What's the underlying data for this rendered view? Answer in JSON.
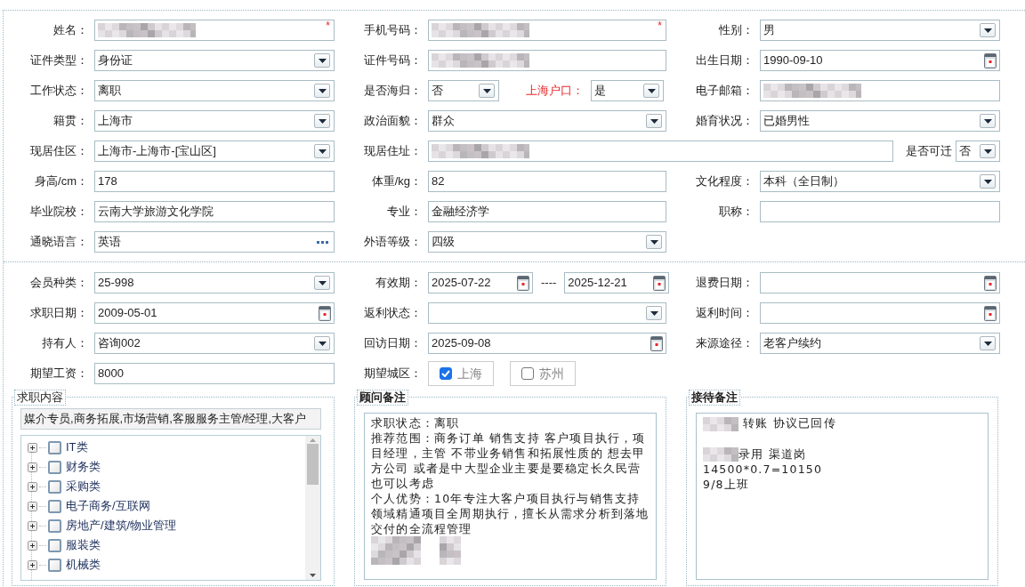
{
  "personal": [
    [
      [
        {
          "label": "姓名：",
          "kind": "text",
          "redacted": true,
          "required_mark": "*"
        }
      ],
      [
        {
          "label": "手机号码：",
          "kind": "text",
          "redacted": true,
          "required_mark": "*"
        }
      ],
      [
        {
          "label": "性别：",
          "kind": "select",
          "value": "男"
        }
      ]
    ],
    [
      [
        {
          "label": "证件类型：",
          "kind": "select",
          "value": "身份证"
        }
      ],
      [
        {
          "label": "证件号码：",
          "kind": "text",
          "redacted": true
        }
      ],
      [
        {
          "label": "出生日期：",
          "kind": "date",
          "value": "1990-09-10"
        }
      ]
    ],
    [
      [
        {
          "label": "工作状态：",
          "kind": "select",
          "value": "离职"
        }
      ],
      [
        {
          "label": "是否海归：",
          "kind": "select",
          "value": "否"
        },
        {
          "label": "上海户口：",
          "kind": "select",
          "value": "是",
          "label_alert": true
        }
      ],
      [
        {
          "label": "电子邮箱：",
          "kind": "text",
          "redacted": true
        }
      ]
    ],
    [
      [
        {
          "label": "籍贯：",
          "kind": "select",
          "value": "上海市"
        }
      ],
      [
        {
          "label": "政治面貌：",
          "kind": "select",
          "value": "群众"
        }
      ],
      [
        {
          "label": "婚育状况：",
          "kind": "select",
          "value": "已婚男性"
        }
      ]
    ],
    [
      [
        {
          "label": "现居住区：",
          "kind": "select",
          "value": " 上海市-上海市-[宝山区]"
        }
      ],
      [
        {
          "label": "现居住址：",
          "kind": "text",
          "redacted": true
        },
        {
          "label": "是否可迁",
          "kind": "select",
          "value": "否"
        }
      ]
    ],
    [
      [
        {
          "label": "身高/cm：",
          "kind": "text",
          "value": "178"
        }
      ],
      [
        {
          "label": "体重/kg：",
          "kind": "text",
          "value": "82"
        }
      ],
      [
        {
          "label": "文化程度：",
          "kind": "select",
          "value": "本科（全日制）"
        }
      ]
    ],
    [
      [
        {
          "label": "毕业院校：",
          "kind": "text",
          "value": "云南大学旅游文化学院"
        }
      ],
      [
        {
          "label": "专业：",
          "kind": "text",
          "value": "金融经济学"
        }
      ],
      [
        {
          "label": "职称：",
          "kind": "text"
        }
      ]
    ],
    [
      [
        {
          "label": "通晓语言：",
          "kind": "lookup",
          "value": "英语"
        }
      ],
      [
        {
          "label": "外语等级：",
          "kind": "select",
          "value": "四级"
        }
      ]
    ]
  ],
  "membership": [
    [
      [
        {
          "label": "会员种类：",
          "kind": "select",
          "value": " 25-998"
        }
      ],
      [
        {
          "label": "有效期：",
          "kind": "daterange",
          "value": "2025-07-22",
          "separator": "----",
          "value_to": "2025-12-21"
        }
      ],
      [
        {
          "label": "退费日期：",
          "kind": "date"
        }
      ]
    ],
    [
      [
        {
          "label": "求职日期：",
          "kind": "date",
          "value": "2009-05-01"
        }
      ],
      [
        {
          "label": "返利状态：",
          "kind": "select"
        }
      ],
      [
        {
          "label": "返利时间：",
          "kind": "date"
        }
      ]
    ],
    [
      [
        {
          "label": "持有人：",
          "kind": "select",
          "value": "咨询002"
        }
      ],
      [
        {
          "label": "回访日期：",
          "kind": "date",
          "value": "2025-09-08"
        }
      ],
      [
        {
          "label": "来源途径：",
          "kind": "select",
          "value": "老客户续约"
        }
      ]
    ],
    [
      [
        {
          "label": "期望工资：",
          "kind": "text",
          "value": "8000"
        }
      ],
      [
        {
          "label": "期望城区：",
          "kind": "checks",
          "options": [
            {
              "label": "上海",
              "checked": true
            },
            {
              "label": "苏州",
              "checked": false
            }
          ]
        }
      ]
    ]
  ],
  "panels": [
    {
      "title": "求职内容",
      "emphasis": false,
      "kind": "tree",
      "summary": "媒介专员,商务拓展,市场营销,客服服务主管/经理,大客户",
      "tree": [
        {
          "label": "IT类",
          "checked": false,
          "expanded": false
        },
        {
          "label": "财务类",
          "checked": false,
          "expanded": false
        },
        {
          "label": "采购类",
          "checked": false,
          "expanded": false
        },
        {
          "label": "电子商务/互联网",
          "checked": false,
          "expanded": false
        },
        {
          "label": "房地产/建筑/物业管理",
          "checked": false,
          "expanded": false
        },
        {
          "label": "服装类",
          "checked": false,
          "expanded": false
        },
        {
          "label": "机械类",
          "checked": false,
          "expanded": false
        }
      ]
    },
    {
      "title": "顾问备注",
      "emphasis": true,
      "kind": "notes",
      "lines": [
        {
          "kind": "text",
          "text": "求职状态：离职"
        },
        {
          "kind": "text",
          "text": "推荐范围：商务订单 销售支持 客户项目执行，项目经理，主管 不带业务销售和拓展性质的 想去甲方公司 或者是中大型企业主要是要稳定长久民营也可以考虑"
        },
        {
          "kind": "text",
          "text": "个人优势：10年专注大客户项目执行与销售支持领域精通项目全周期执行，擅长从需求分析到落地交付的全流程管理"
        },
        {
          "kind": "redacted"
        }
      ]
    },
    {
      "title": "接待备注",
      "emphasis": true,
      "kind": "notes",
      "lines": [
        {
          "kind": "blurred-text",
          "text": " 转账 协议已回传"
        },
        {
          "kind": "blank"
        },
        {
          "kind": "blurred-text",
          "text": "录用 渠道岗"
        },
        {
          "kind": "text",
          "text": "14500*0.7=10150"
        },
        {
          "kind": "text",
          "text": "9/8上班"
        }
      ]
    }
  ]
}
